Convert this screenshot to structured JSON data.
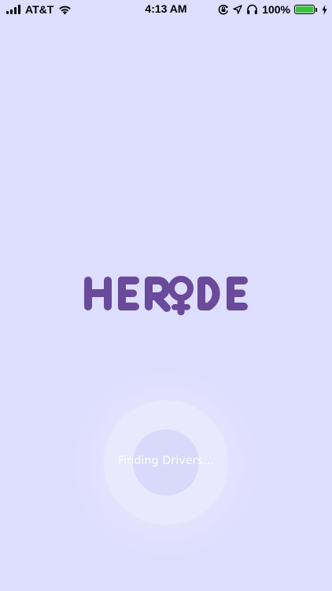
{
  "status_bar": {
    "carrier": "AT&T",
    "time": "4:13 AM",
    "battery_percent": "100%",
    "battery_level": 1.0,
    "icons": [
      "signal-icon",
      "wifi-icon",
      "screen-lock-icon",
      "location-icon",
      "headphones-icon",
      "battery-icon",
      "charging-icon"
    ]
  },
  "logo": {
    "text": "HERIDE",
    "color": "#6a4a9a"
  },
  "loader": {
    "text": "Finding Drivers..."
  },
  "colors": {
    "background": "#dedefe",
    "brand": "#6a4a9a"
  }
}
